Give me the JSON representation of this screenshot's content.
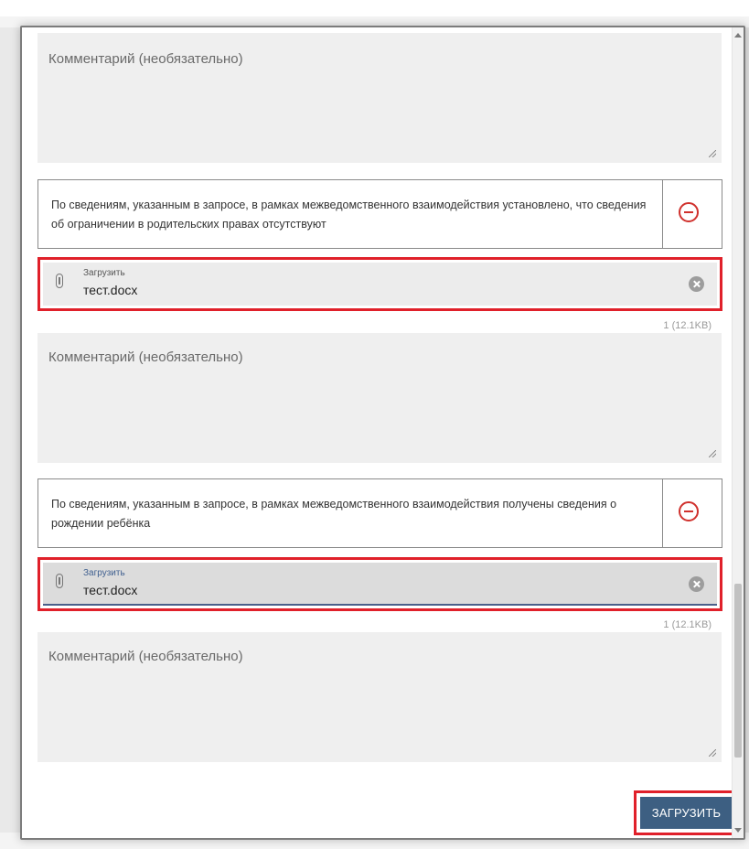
{
  "comment_placeholder": "Комментарий (необязательно)",
  "items": [
    {
      "info": "По сведениям, указанным в запросе, в рамках межведомственного взаимодействия установлено, что сведения об ограничении в родительских правах отсутствуют",
      "upload_label": "Загрузить",
      "file_name": "тест.docx",
      "file_size": "1 (12.1KB)"
    },
    {
      "info": "По сведениям, указанным в запросе, в рамках межведомственного взаимодействия получены сведения о рождении ребёнка",
      "upload_label": "Загрузить",
      "file_name": "тест.docx",
      "file_size": "1 (12.1KB)"
    }
  ],
  "submit_label": "ЗАГРУЗИТЬ",
  "colors": {
    "highlight": "#e0202a",
    "primary": "#3d5f82",
    "remove": "#d0312d"
  },
  "icons": [
    "paperclip-icon",
    "remove-circle-icon",
    "clear-file-icon",
    "resize-handle-icon"
  ]
}
